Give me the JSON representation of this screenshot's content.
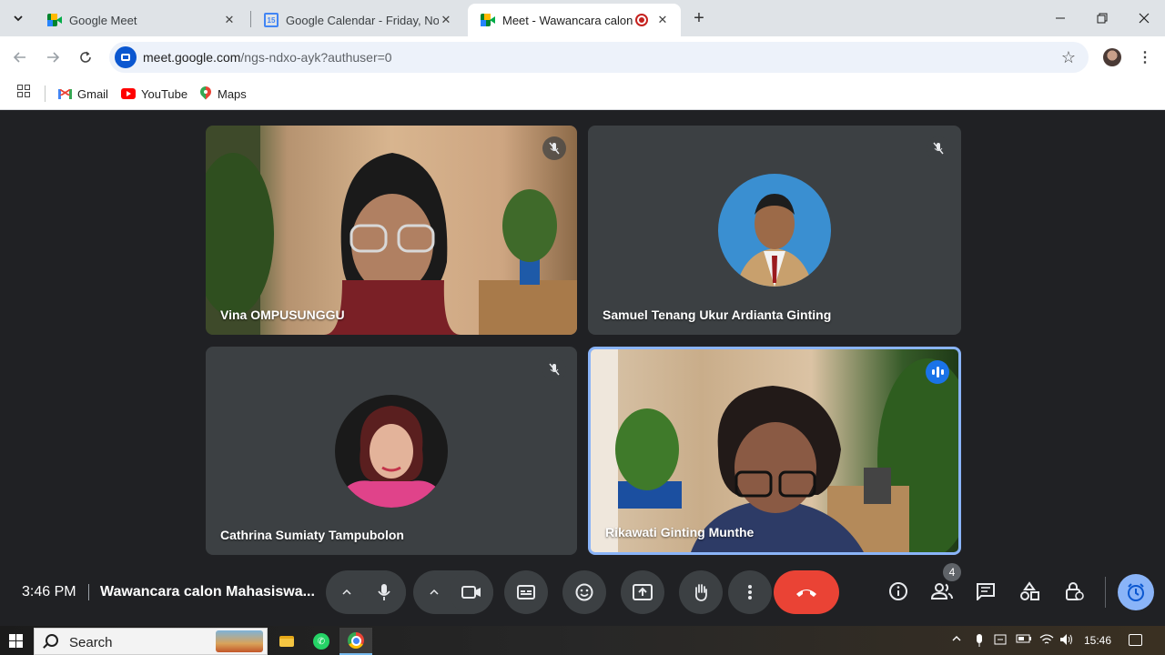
{
  "browser": {
    "tabs": [
      {
        "title": "Google Meet",
        "icon": "meet-icon"
      },
      {
        "title": "Google Calendar - Friday, Nove",
        "icon": "calendar-icon",
        "icon_text": "15"
      },
      {
        "title": "Meet - Wawancara calon M",
        "icon": "meet-icon",
        "recording": true
      }
    ],
    "new_tab": "+",
    "url_host": "meet.google.com",
    "url_path": "/ngs-ndxo-ayk?authuser=0",
    "bookmarks": [
      {
        "label": "Gmail",
        "icon": "gmail-icon"
      },
      {
        "label": "YouTube",
        "icon": "youtube-icon"
      },
      {
        "label": "Maps",
        "icon": "maps-icon"
      }
    ]
  },
  "meeting": {
    "time": "3:46 PM",
    "title": "Wawancara calon Mahasiswa...",
    "participant_count": "4",
    "participants": [
      {
        "name": "Vina OMPUSUNGGU",
        "muted": true,
        "video": true
      },
      {
        "name": "Samuel Tenang Ukur Ardianta Ginting",
        "muted": true,
        "video": false
      },
      {
        "name": "Cathrina Sumiaty Tampubolon",
        "muted": true,
        "video": false
      },
      {
        "name": "Rikawati Ginting Munthe",
        "muted": false,
        "speaking": true,
        "video": true
      }
    ]
  },
  "taskbar": {
    "search_label": "Search",
    "time": "15:46"
  },
  "colors": {
    "meet_bg": "#202124",
    "tile_bg": "#3c4043",
    "hangup_red": "#ea4335",
    "active_speaker_blue": "#8ab4f8"
  }
}
